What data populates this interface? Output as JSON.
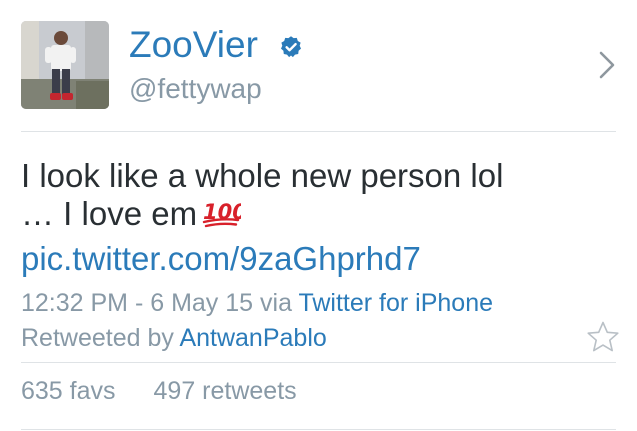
{
  "user": {
    "display_name": "ZooVier",
    "handle": "@fettywap",
    "verified": true,
    "avatar_icon": "profile-photo"
  },
  "tweet": {
    "text_line1": "I look like a whole new person lol",
    "text_line2": "… I love em",
    "emoji": "💯",
    "link": "pic.twitter.com/9zaGhprhd7",
    "timestamp": "12:32 PM - 6 May 15",
    "via_label": "via",
    "source": "Twitter for iPhone",
    "retweeted_by_label": "Retweeted by",
    "retweeted_by": "AntwanPablo"
  },
  "stats": {
    "favs": "635 favs",
    "retweets": "497 retweets"
  },
  "icons": {
    "verified": "verified-badge-icon",
    "chevron": "chevron-right-icon",
    "favorite": "star-icon"
  },
  "colors": {
    "link_blue": "#2b7bb9",
    "text": "#292f33",
    "muted": "#8899a6",
    "divider": "#dfe3e6"
  }
}
